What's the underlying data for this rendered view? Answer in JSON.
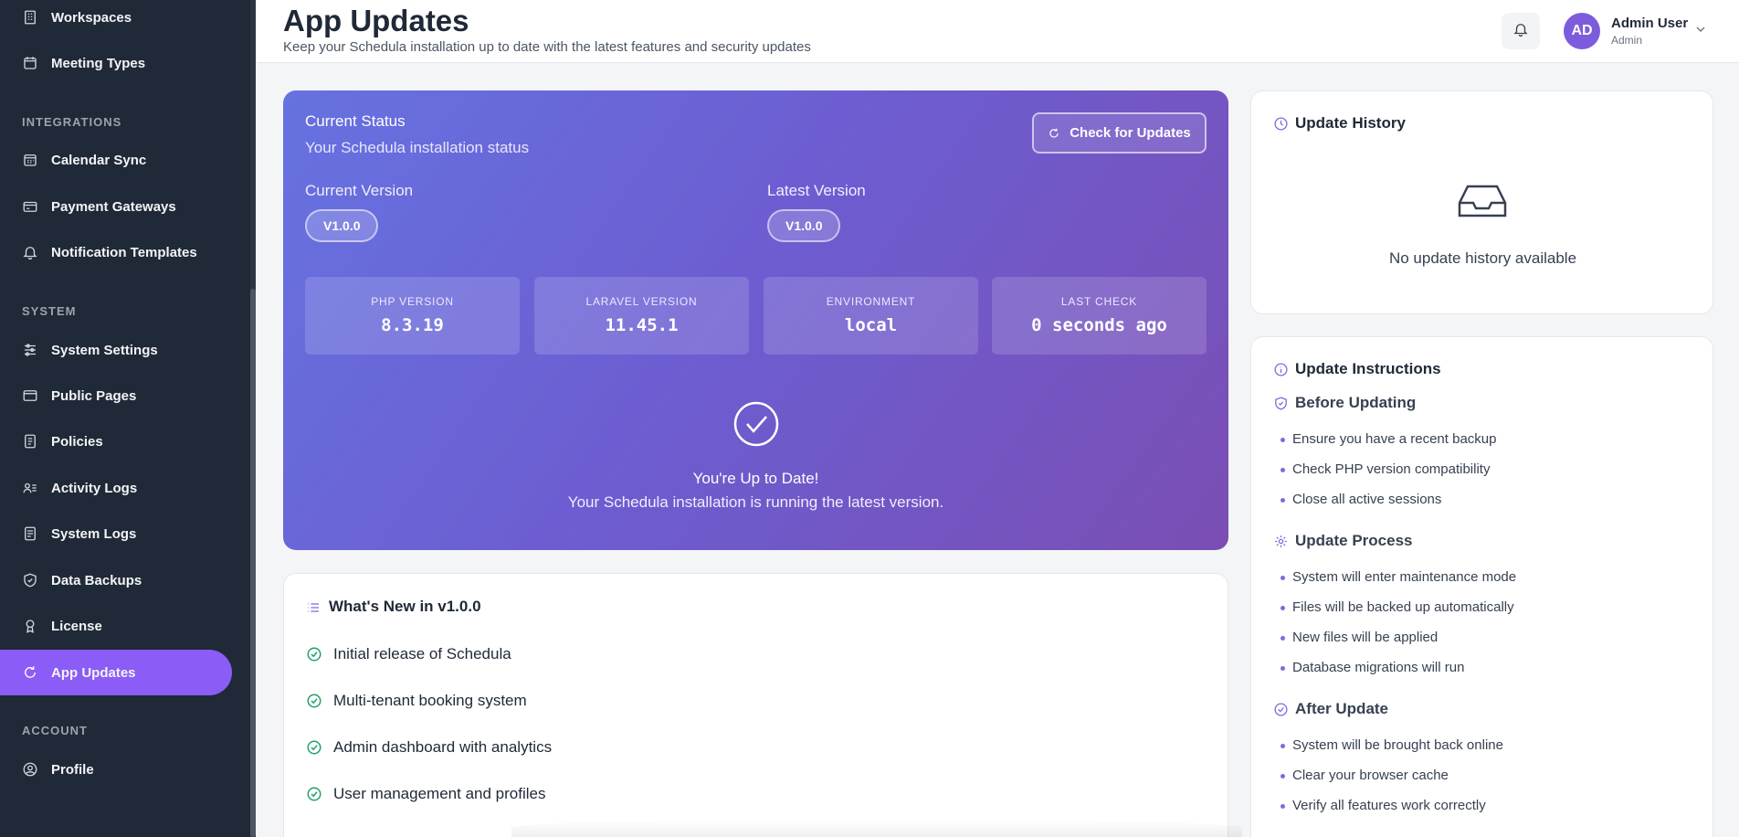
{
  "sidebar": {
    "sections": {
      "integrations": "INTEGRATIONS",
      "system": "SYSTEM",
      "account": "ACCOUNT"
    },
    "items": [
      {
        "label": "Workspaces",
        "icon": "building-icon"
      },
      {
        "label": "Meeting Types",
        "icon": "calendar-icon"
      },
      {
        "label": "Calendar Sync",
        "icon": "calendar-grid-icon"
      },
      {
        "label": "Payment Gateways",
        "icon": "credit-card-icon"
      },
      {
        "label": "Notification Templates",
        "icon": "bell-icon"
      },
      {
        "label": "System Settings",
        "icon": "sliders-icon"
      },
      {
        "label": "Public Pages",
        "icon": "browser-icon"
      },
      {
        "label": "Policies",
        "icon": "document-icon"
      },
      {
        "label": "Activity Logs",
        "icon": "user-list-icon"
      },
      {
        "label": "System Logs",
        "icon": "log-icon"
      },
      {
        "label": "Data Backups",
        "icon": "shield-icon"
      },
      {
        "label": "License",
        "icon": "badge-icon"
      },
      {
        "label": "App Updates",
        "icon": "refresh-icon",
        "active": true
      },
      {
        "label": "Profile",
        "icon": "user-circle-icon"
      }
    ]
  },
  "header": {
    "title": "App Updates",
    "subtitle": "Keep your Schedula installation up to date with the latest features and security updates",
    "user": {
      "initials": "AD",
      "name": "Admin User",
      "role": "Admin"
    }
  },
  "status": {
    "title": "Current Status",
    "subtitle": "Your Schedula installation status",
    "check_button": "Check for Updates",
    "current_version_label": "Current Version",
    "current_version": "V1.0.0",
    "latest_version_label": "Latest Version",
    "latest_version": "V1.0.0",
    "info": [
      {
        "label": "PHP VERSION",
        "value": "8.3.19"
      },
      {
        "label": "LARAVEL VERSION",
        "value": "11.45.1"
      },
      {
        "label": "ENVIRONMENT",
        "value": "local"
      },
      {
        "label": "LAST CHECK",
        "value": "0 seconds ago"
      }
    ],
    "uptodate_title": "You're Up to Date!",
    "uptodate_sub": "Your Schedula installation is running the latest version."
  },
  "whats_new": {
    "title": "What's New in v1.0.0",
    "features": [
      "Initial release of Schedula",
      "Multi-tenant booking system",
      "Admin dashboard with analytics",
      "User management and profiles"
    ]
  },
  "history": {
    "title": "Update History",
    "empty": "No update history available"
  },
  "instructions": {
    "title": "Update Instructions",
    "before": {
      "title": "Before Updating",
      "items": [
        "Ensure you have a recent backup",
        "Check PHP version compatibility",
        "Close all active sessions"
      ]
    },
    "process": {
      "title": "Update Process",
      "items": [
        "System will enter maintenance mode",
        "Files will be backed up automatically",
        "New files will be applied",
        "Database migrations will run"
      ]
    },
    "after": {
      "title": "After Update",
      "items": [
        "System will be brought back online",
        "Clear your browser cache",
        "Verify all features work correctly"
      ]
    }
  },
  "colors": {
    "accent": "#8b5cf6",
    "sidebar": "#1f2937",
    "success": "#22a06b"
  }
}
